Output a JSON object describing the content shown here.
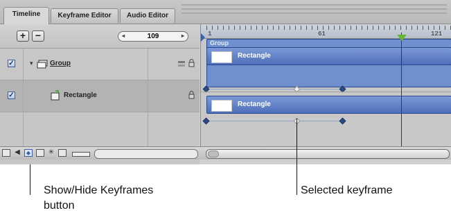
{
  "tabs": [
    {
      "label": "Timeline",
      "active": true
    },
    {
      "label": "Keyframe Editor",
      "active": false
    },
    {
      "label": "Audio Editor",
      "active": false
    }
  ],
  "controls": {
    "add_label": "+",
    "remove_label": "−",
    "frame_value": "109",
    "left_arrow": "◂",
    "right_arrow": "▸"
  },
  "layers": [
    {
      "name": "Group",
      "checked": true,
      "icon": "group-icon"
    },
    {
      "name": "Rectangle",
      "checked": true,
      "icon": "shape-layer-icon"
    }
  ],
  "checkbox_mark": "✓",
  "disclosure_mark": "▾",
  "ruler": {
    "labels": [
      "1",
      "61",
      "121"
    ]
  },
  "timeline": {
    "group_label": "Group",
    "bars": [
      {
        "label": "Rectangle"
      },
      {
        "label": "Rectangle"
      }
    ]
  },
  "footer_icons": [
    "layers-view-icon",
    "audio-icon",
    "show-hide-keyframes-icon",
    "clip-view-icon",
    "filter-icon",
    "masks-icon",
    "track-size-icon"
  ],
  "callouts": {
    "show_hide": "Show/Hide Keyframes button",
    "selected": "Selected keyframe"
  },
  "colors": {
    "bar": "#5a7bc4",
    "playhead": "#66b532",
    "panel": "#cfcfcf"
  }
}
